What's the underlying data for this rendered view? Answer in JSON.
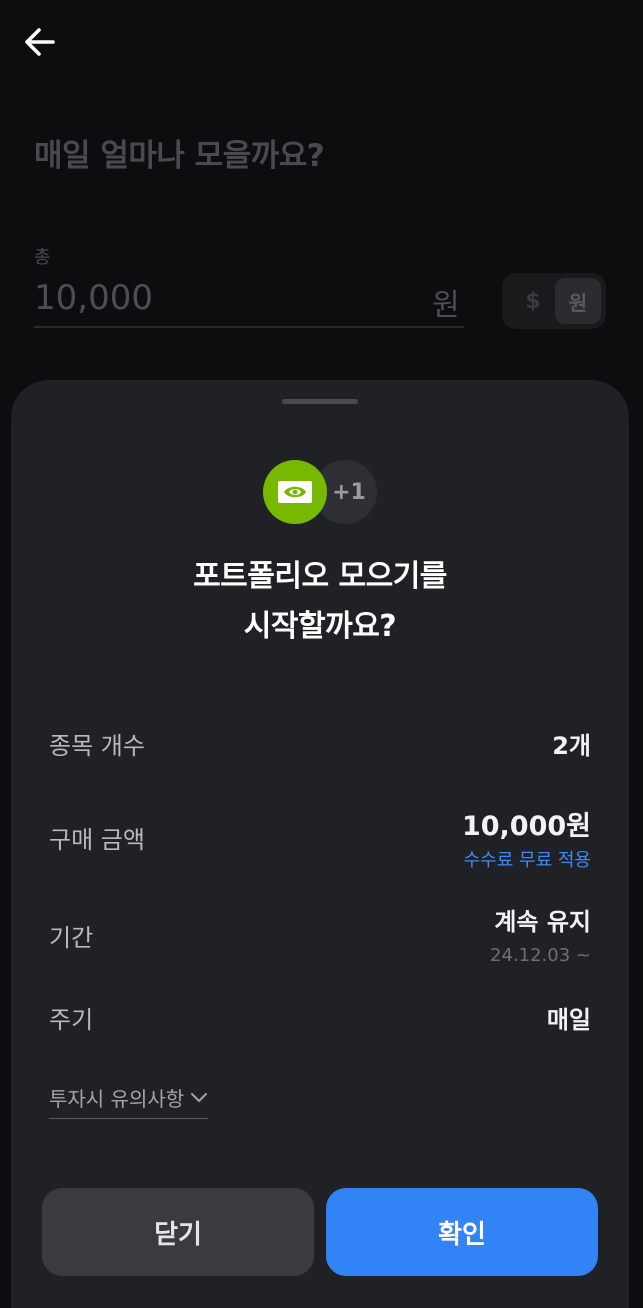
{
  "page": {
    "title": "매일 얼마나 모을까요?",
    "amount_caption": "총",
    "amount_value": "10,000",
    "amount_unit": "원",
    "currency_usd": "$",
    "currency_krw": "원",
    "back_icon": "arrow-left-icon"
  },
  "sheet": {
    "logos": {
      "primary_icon": "nvidia-logo-icon",
      "more_count": "+1"
    },
    "title_line1": "포트폴리오 모으기를",
    "title_line2": "시작할까요?",
    "rows": {
      "count_label": "종목 개수",
      "count_value": "2개",
      "amount_label": "구매 금액",
      "amount_value": "10,000원",
      "amount_note": "수수료 무료 적용",
      "period_label": "기간",
      "period_value": "계속 유지",
      "period_note": "24.12.03 ~",
      "cycle_label": "주기",
      "cycle_value": "매일"
    },
    "notice_label": "투자시 유의사항",
    "notice_icon": "chevron-down-icon",
    "close_label": "닫기",
    "confirm_label": "확인"
  },
  "colors": {
    "accent": "#3183f6",
    "note_blue": "#3a8bf7",
    "nvidia_green": "#76b900",
    "sheet_bg": "#202125"
  }
}
